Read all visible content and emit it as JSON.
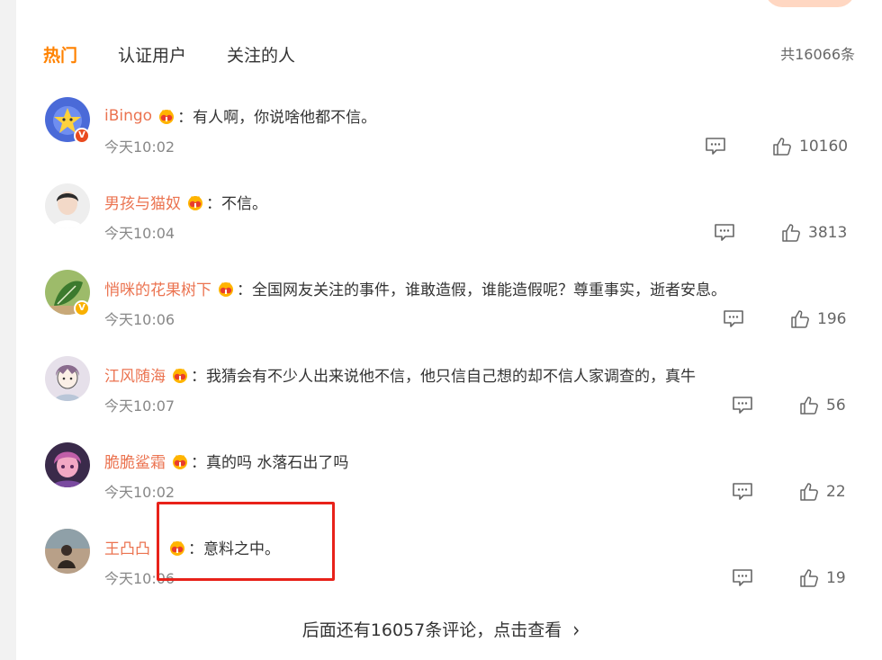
{
  "tabs": [
    {
      "label": "热门"
    },
    {
      "label": "认证用户"
    },
    {
      "label": "关注的人"
    }
  ],
  "total_label": "共16066条",
  "comments": [
    {
      "name": "iBingo",
      "text": "：有人啊，你说啥他都不信。",
      "time": "今天10:02",
      "likes": "10160",
      "verify": "red"
    },
    {
      "name": "男孩与猫奴",
      "text": "：不信。",
      "time": "今天10:04",
      "likes": "3813",
      "verify": ""
    },
    {
      "name": "悄咪的花果树下",
      "text": "：全国网友关注的事件，谁敢造假，谁能造假呢？尊重事实，逝者安息。",
      "time": "今天10:06",
      "likes": "196",
      "verify": "gold"
    },
    {
      "name": "江风随海",
      "text": "：我猜会有不少人出来说他不信，他只信自己想的却不信人家调查的，真牛",
      "time": "今天10:07",
      "likes": "56",
      "verify": ""
    },
    {
      "name": "脆脆鲨霜",
      "text": "：真的吗 水落石出了吗",
      "time": "今天10:02",
      "likes": "22",
      "verify": ""
    },
    {
      "name": "王凸凸",
      "text": "：意料之中。",
      "time": "今天10:06",
      "likes": "19",
      "verify": ""
    }
  ],
  "more_label": "后面还有16057条评论，点击查看",
  "colors": {
    "accent": "#ff8200",
    "name": "#eb7350",
    "highlight_box": "#e8221a"
  }
}
